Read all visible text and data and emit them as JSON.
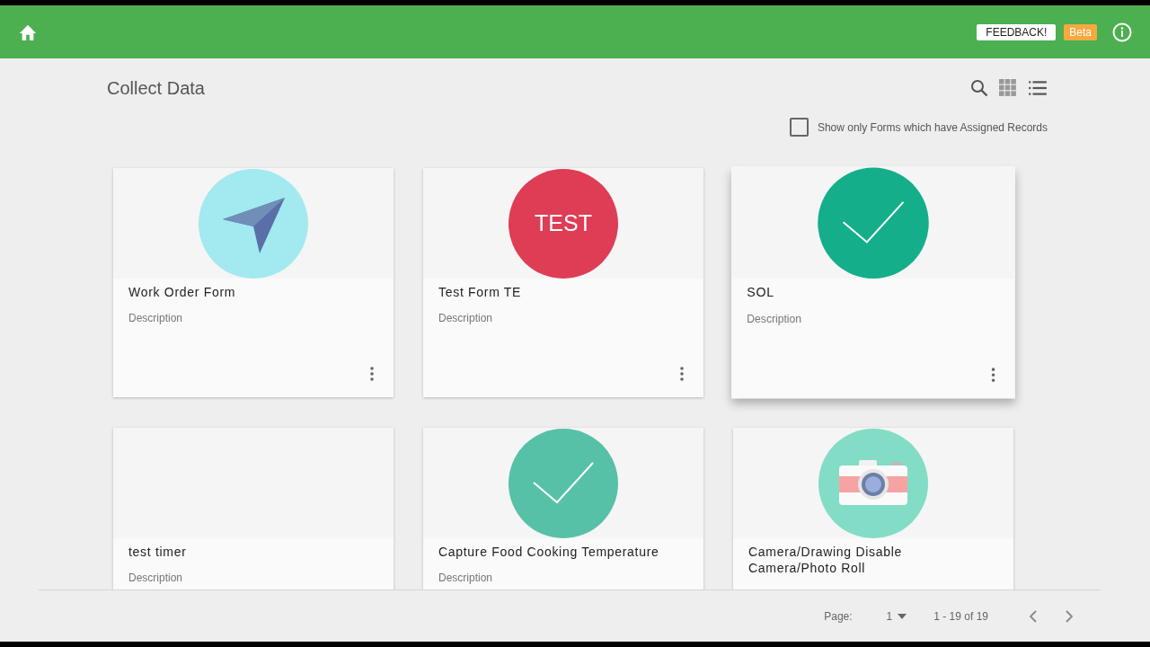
{
  "header": {
    "feedback": "FEEDBACK!",
    "badge": "Beta"
  },
  "page": {
    "title": "Collect Data"
  },
  "view": {
    "grid_selected": true
  },
  "filter": {
    "label": "Show only Forms which have Assigned Records",
    "checked": false
  },
  "cards": [
    {
      "title": "Work Order Form",
      "description": "Description",
      "kind": "plane",
      "color": "#a3e9f0",
      "raised": false
    },
    {
      "title": "Test Form TE",
      "description": "Description",
      "kind": "text",
      "text": "TEST",
      "color": "#de3d55",
      "raised": false
    },
    {
      "title": "SOL",
      "description": "Description",
      "kind": "check",
      "color": "#14ae8a",
      "raised": true
    },
    {
      "title": "test timer",
      "description": "Description",
      "kind": "none",
      "raised": false
    },
    {
      "title": "Capture Food Cooking Temperature",
      "description": "Description",
      "kind": "check",
      "color": "#56c1a6",
      "raised": false
    },
    {
      "title": "Camera/Drawing Disable Camera/Photo Roll",
      "kind": "camera",
      "color": "#83dcc5",
      "raised": false
    }
  ],
  "pagination": {
    "label": "Page:",
    "page": "1",
    "range": "1 - 19 of 19"
  }
}
